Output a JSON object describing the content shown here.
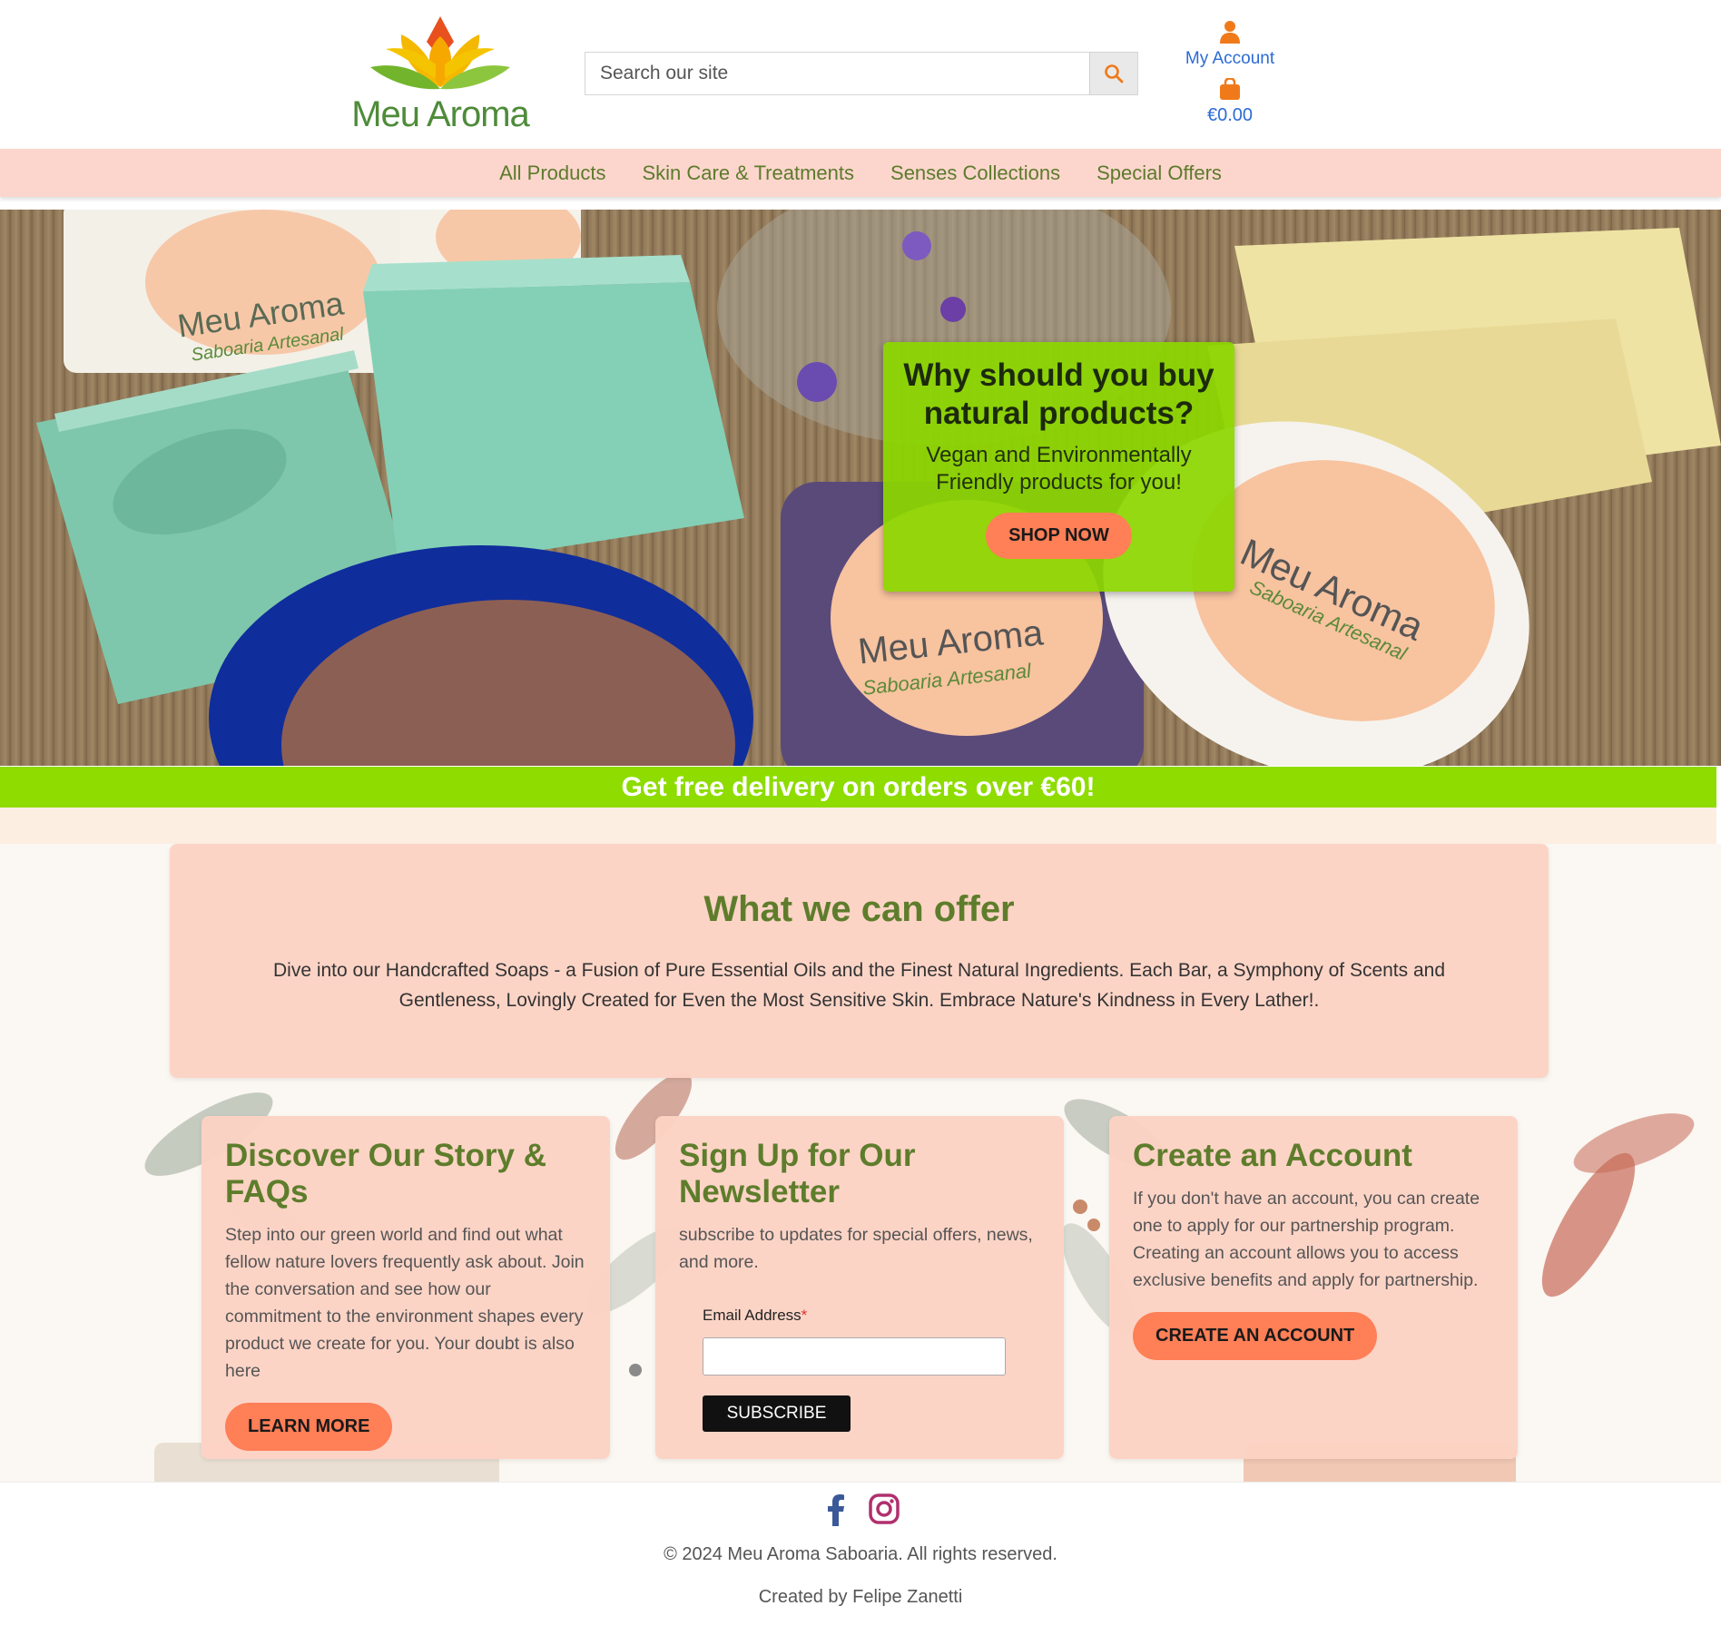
{
  "header": {
    "logo_text": "Meu Aroma",
    "search_placeholder": "Search our site",
    "account_label": "My Account",
    "cart_total": "€0.00"
  },
  "nav": {
    "items": [
      "All Products",
      "Skin Care & Treatments",
      "Senses Collections",
      "Special Offers"
    ]
  },
  "hero": {
    "title": "Why should you buy natural products?",
    "text": "Vegan and Environmentally Friendly products for you!",
    "button": "SHOP NOW"
  },
  "delivery_banner": "Get free delivery on orders over €60!",
  "offer": {
    "title": "What we can offer",
    "text": "Dive into our Handcrafted Soaps - a Fusion of Pure Essential Oils and the Finest Natural Ingredients. Each Bar, a Symphony of Scents and Gentleness, Lovingly Created for Even the Most Sensitive Skin. Embrace Nature's Kindness in Every Lather!."
  },
  "cards": {
    "story": {
      "title": "Discover Our Story & FAQs",
      "text": "Step into our green world and find out what fellow nature lovers frequently ask about. Join the conversation and see how our commitment to the environment shapes every product we create for you. Your doubt is also here",
      "button": "LEARN MORE"
    },
    "newsletter": {
      "title": "Sign Up for Our Newsletter",
      "text": "subscribe to updates for special offers, news, and more.",
      "email_label": "Email Address",
      "required_mark": "*",
      "button": "SUBSCRIBE"
    },
    "account": {
      "title": "Create an Account",
      "text": "If you don't have an account, you can create one to apply for our partnership program. Creating an account allows you to access exclusive benefits and apply for partnership.",
      "button": "CREATE AN ACCOUNT"
    }
  },
  "footer": {
    "copyright": "© 2024 Meu Aroma Saboaria. All rights reserved.",
    "credits": "Created by Felipe Zanetti"
  },
  "soap_labels": {
    "brand": "Meu Aroma",
    "subtitle": "Saboaria Artesanal"
  },
  "icons": [
    "user-icon",
    "shopping-bag-icon",
    "search-icon",
    "facebook-icon",
    "instagram-icon"
  ],
  "colors": {
    "accent_orange": "#ff7f57",
    "brand_green": "#5e7d2c",
    "lime": "#8edc00",
    "peach": "#fcd6cc",
    "link_blue": "#2c6bd6"
  }
}
